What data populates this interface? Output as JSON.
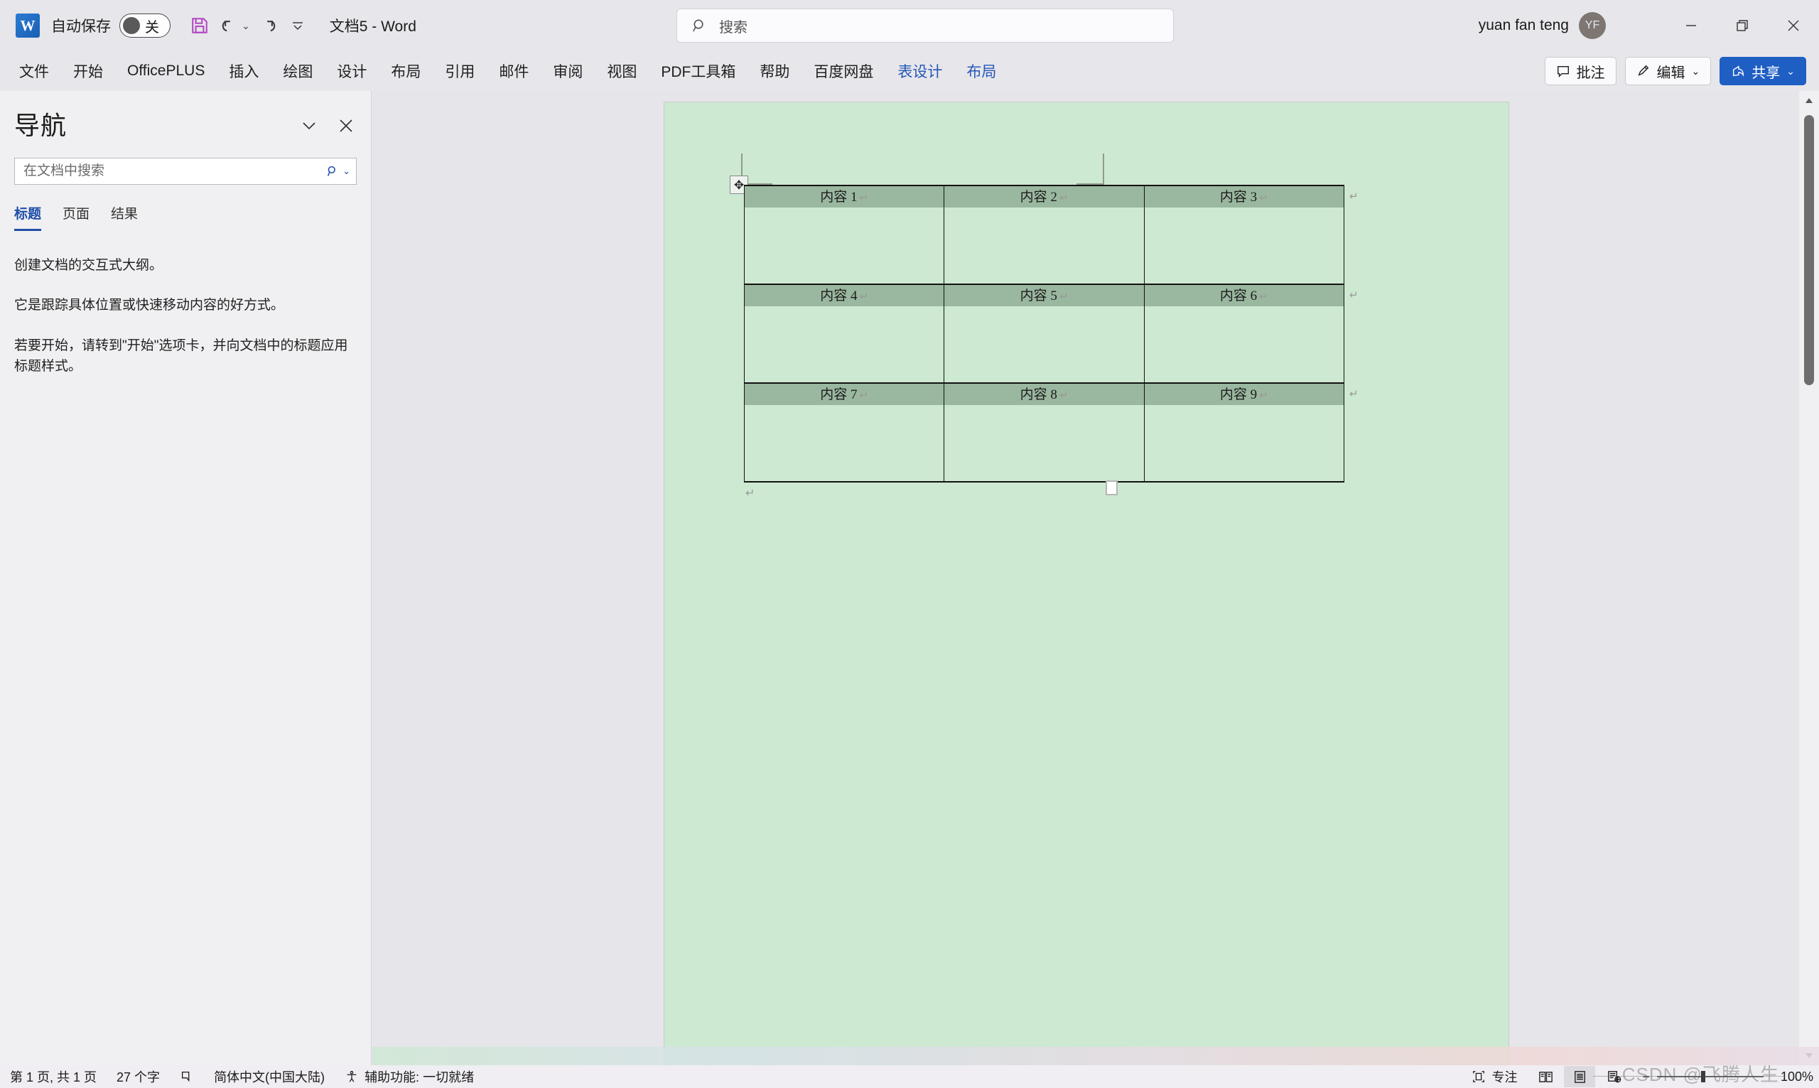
{
  "titlebar": {
    "app_logo_letter": "W",
    "autosave_label": "自动保存",
    "autosave_state": "关",
    "save_icon": "save-icon",
    "undo_icon": "undo-icon",
    "redo_icon": "redo-icon",
    "customize_icon": "customize-quick-access-icon",
    "document_title": "文档5  -  Word",
    "search_placeholder": "搜索",
    "search_icon": "search-icon",
    "account_name": "yuan fan teng",
    "account_initials": "YF",
    "minimize": "minimize-icon",
    "restore": "restore-icon",
    "close": "close-icon"
  },
  "ribbon": {
    "tabs": [
      {
        "label": "文件",
        "contextual": false
      },
      {
        "label": "开始",
        "contextual": false
      },
      {
        "label": "OfficePLUS",
        "contextual": false
      },
      {
        "label": "插入",
        "contextual": false
      },
      {
        "label": "绘图",
        "contextual": false
      },
      {
        "label": "设计",
        "contextual": false
      },
      {
        "label": "布局",
        "contextual": false
      },
      {
        "label": "引用",
        "contextual": false
      },
      {
        "label": "邮件",
        "contextual": false
      },
      {
        "label": "审阅",
        "contextual": false
      },
      {
        "label": "视图",
        "contextual": false
      },
      {
        "label": "PDF工具箱",
        "contextual": false
      },
      {
        "label": "帮助",
        "contextual": false
      },
      {
        "label": "百度网盘",
        "contextual": false
      },
      {
        "label": "表设计",
        "contextual": true
      },
      {
        "label": "布局",
        "contextual": true
      }
    ],
    "comments_label": "批注",
    "comments_icon": "comment-icon",
    "editing_label": "编辑",
    "editing_icon": "pencil-icon",
    "share_label": "共享",
    "share_icon": "share-icon",
    "accent_color": "#1f5fc4",
    "contextual_color": "#2458b8"
  },
  "navigation": {
    "title": "导航",
    "collapse_icon": "chevron-down-icon",
    "close_icon": "close-icon",
    "search_placeholder": "在文档中搜索",
    "search_value": "",
    "search_icon": "magnifier-icon",
    "search_dropdown_icon": "chevron-down-icon",
    "tabs": [
      {
        "label": "标题",
        "active": true
      },
      {
        "label": "页面",
        "active": false
      },
      {
        "label": "结果",
        "active": false
      }
    ],
    "paragraphs": [
      "创建文档的交互式大纲。",
      "它是跟踪具体位置或快速移动内容的好方式。",
      "若要开始，请转到\"开始\"选项卡，并向文档中的标题应用标题样式。"
    ]
  },
  "document": {
    "page_background": "#cde9d1",
    "table_header_fill": "#9ab79f",
    "table_cell_fill": "#cde9d1",
    "table_move_handle_icon": "move-table-icon",
    "paragraph_mark": "↵",
    "end_paragraph_mark": "↵",
    "resize_handle": "table-resize-handle",
    "table": {
      "rows": [
        {
          "header": [
            "内容 1",
            "内容 2",
            "内容 3"
          ]
        },
        {
          "header": [
            "内容 4",
            "内容 5",
            "内容 6"
          ]
        },
        {
          "header": [
            "内容 7",
            "内容 8",
            "内容 9"
          ]
        }
      ]
    }
  },
  "scrollbar": {
    "up_icon": "scroll-up-icon",
    "down_icon": "scroll-down-icon"
  },
  "statusbar": {
    "page_info": "第 1 页, 共 1 页",
    "word_count": "27 个字",
    "proofing_icon": "proofing-icon",
    "language": "简体中文(中国大陆)",
    "accessibility_icon": "accessibility-icon",
    "accessibility": "辅助功能: 一切就绪",
    "focus_icon": "focus-icon",
    "focus_label": "专注",
    "view_read_icon": "read-mode-icon",
    "view_print_icon": "print-layout-icon",
    "view_web_icon": "web-layout-icon",
    "zoom_out": "−",
    "zoom_in": "+",
    "zoom_level": "100%",
    "watermark": "CSDN @飞腾人生"
  }
}
